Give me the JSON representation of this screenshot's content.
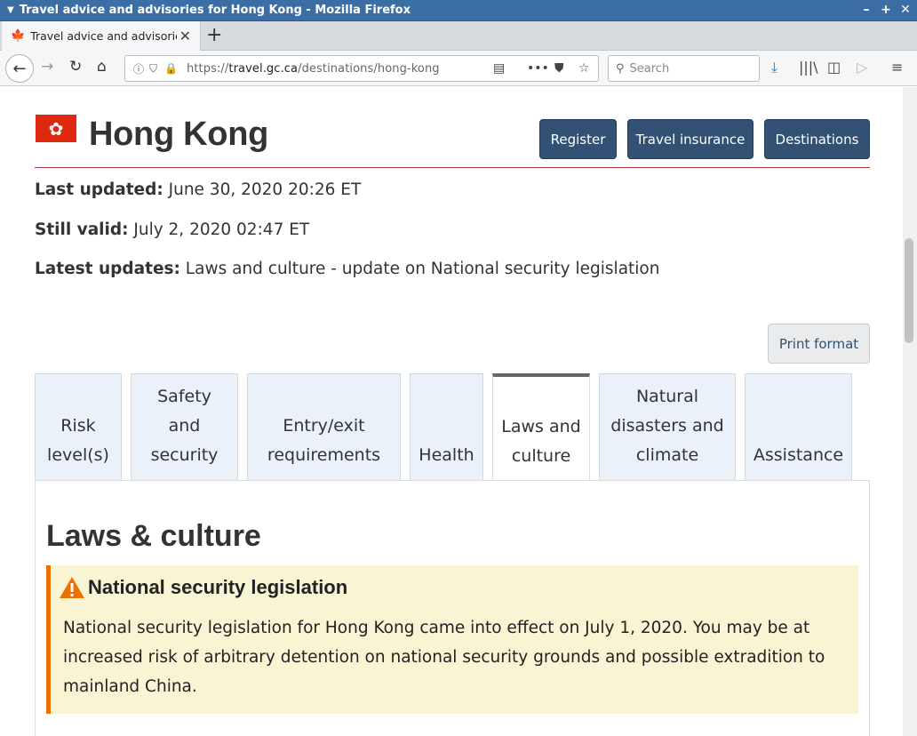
{
  "window": {
    "title": "Travel advice and advisories for Hong Kong - Mozilla Firefox",
    "controls": [
      "–",
      "+",
      "✕"
    ]
  },
  "browser": {
    "tab_title": "Travel advice and advisories for Hong Kong",
    "tab_close": "✕",
    "new_tab": "+",
    "url_prefix": "https://",
    "url_host": "travel.gc.ca",
    "url_path": "/destinations/hong-kong",
    "search_placeholder": "Search"
  },
  "page": {
    "country": "Hong Kong",
    "flag_symbol": "✿",
    "buttons": {
      "register": "Register",
      "travel_insurance": "Travel insurance",
      "destinations": "Destinations",
      "print": "Print format"
    },
    "meta": {
      "last_updated_label": "Last updated:",
      "last_updated_value": "June 30, 2020 20:26 ET",
      "still_valid_label": "Still valid:",
      "still_valid_value": "July 2, 2020 02:47 ET",
      "latest_updates_label": "Latest updates:",
      "latest_updates_value": "Laws and culture - update on National security legislation"
    },
    "tabs": [
      {
        "label": "Risk level(s)"
      },
      {
        "label": "Safety and security"
      },
      {
        "label": "Entry/exit requirements"
      },
      {
        "label": "Health"
      },
      {
        "label": "Laws and culture"
      },
      {
        "label": "Natural disasters and climate"
      },
      {
        "label": "Assistance"
      }
    ],
    "active_tab": "Laws and culture",
    "section_title": "Laws & culture",
    "alert": {
      "title": "National security legislation",
      "body": "National security legislation for Hong Kong came into effect on July 1, 2020. You may be at increased risk of arbitrary detention on national security grounds and possible extradition to mainland China."
    }
  },
  "colors": {
    "titlebar": "#3a6ea5",
    "button_primary": "#335075",
    "rule": "#af3c43",
    "alert_bg": "#f9f4d4",
    "alert_border": "#ee7100",
    "flag": "#de2910"
  }
}
